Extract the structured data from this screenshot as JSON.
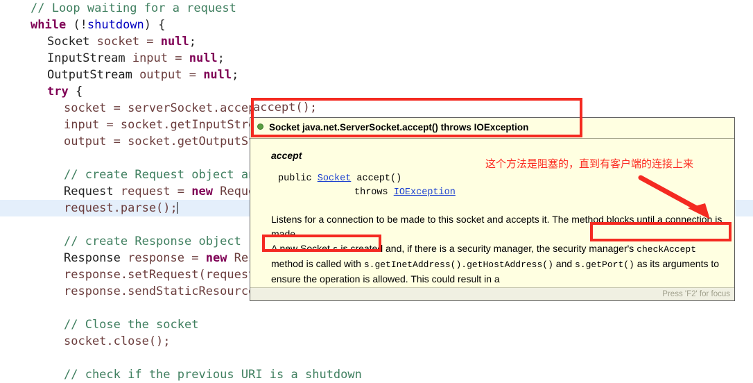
{
  "editor": {
    "lines": [
      {
        "indent": 1,
        "current": false,
        "tokens": [
          {
            "t": "// Loop waiting for a request",
            "c": "cm"
          }
        ]
      },
      {
        "indent": 1,
        "current": false,
        "tokens": [
          {
            "t": "while",
            "c": "kw"
          },
          {
            "t": " (!",
            "c": "pl"
          },
          {
            "t": "shutdown",
            "c": "fld"
          },
          {
            "t": ") {",
            "c": "pl"
          }
        ]
      },
      {
        "indent": 2,
        "current": false,
        "tokens": [
          {
            "t": "Socket",
            "c": "pl"
          },
          {
            "t": " socket = ",
            "c": "id"
          },
          {
            "t": "null",
            "c": "kw"
          },
          {
            "t": ";",
            "c": "pl"
          }
        ]
      },
      {
        "indent": 2,
        "current": false,
        "tokens": [
          {
            "t": "InputStream",
            "c": "pl"
          },
          {
            "t": " input = ",
            "c": "id"
          },
          {
            "t": "null",
            "c": "kw"
          },
          {
            "t": ";",
            "c": "pl"
          }
        ]
      },
      {
        "indent": 2,
        "current": false,
        "tokens": [
          {
            "t": "OutputStream",
            "c": "pl"
          },
          {
            "t": " output = ",
            "c": "id"
          },
          {
            "t": "null",
            "c": "kw"
          },
          {
            "t": ";",
            "c": "pl"
          }
        ]
      },
      {
        "indent": 2,
        "current": false,
        "tokens": [
          {
            "t": "try",
            "c": "kw"
          },
          {
            "t": " {",
            "c": "pl"
          }
        ]
      },
      {
        "indent": 3,
        "current": false,
        "tokens": [
          {
            "t": "socket = serverSocket.accept();",
            "c": "id"
          }
        ]
      },
      {
        "indent": 3,
        "current": false,
        "tokens": [
          {
            "t": "input = socket.getInputStream();",
            "c": "id"
          }
        ]
      },
      {
        "indent": 3,
        "current": false,
        "tokens": [
          {
            "t": "output = socket.getOutputStream();",
            "c": "id"
          }
        ]
      },
      {
        "indent": 3,
        "current": false,
        "tokens": [
          {
            "t": "",
            "c": "pl"
          }
        ]
      },
      {
        "indent": 3,
        "current": false,
        "tokens": [
          {
            "t": "// create Request object and parse",
            "c": "cm"
          }
        ]
      },
      {
        "indent": 3,
        "current": false,
        "tokens": [
          {
            "t": "Request",
            "c": "pl"
          },
          {
            "t": " request = ",
            "c": "id"
          },
          {
            "t": "new",
            "c": "kw"
          },
          {
            "t": " Request(input);",
            "c": "id"
          }
        ]
      },
      {
        "indent": 3,
        "current": true,
        "tokens": [
          {
            "t": "request.parse();",
            "c": "id"
          }
        ]
      },
      {
        "indent": 3,
        "current": false,
        "tokens": [
          {
            "t": "",
            "c": "pl"
          }
        ]
      },
      {
        "indent": 3,
        "current": false,
        "tokens": [
          {
            "t": "// create Response object",
            "c": "cm"
          }
        ]
      },
      {
        "indent": 3,
        "current": false,
        "tokens": [
          {
            "t": "Response",
            "c": "pl"
          },
          {
            "t": " response = ",
            "c": "id"
          },
          {
            "t": "new",
            "c": "kw"
          },
          {
            "t": " Response(output);",
            "c": "id"
          }
        ]
      },
      {
        "indent": 3,
        "current": false,
        "tokens": [
          {
            "t": "response.setRequest(request);",
            "c": "id"
          }
        ]
      },
      {
        "indent": 3,
        "current": false,
        "tokens": [
          {
            "t": "response.sendStaticResource();",
            "c": "id"
          }
        ]
      },
      {
        "indent": 3,
        "current": false,
        "tokens": [
          {
            "t": "",
            "c": "pl"
          }
        ]
      },
      {
        "indent": 3,
        "current": false,
        "tokens": [
          {
            "t": "// Close the socket",
            "c": "cm"
          }
        ]
      },
      {
        "indent": 3,
        "current": false,
        "tokens": [
          {
            "t": "socket.close();",
            "c": "id"
          }
        ]
      },
      {
        "indent": 3,
        "current": false,
        "tokens": [
          {
            "t": "",
            "c": "pl"
          }
        ]
      },
      {
        "indent": 3,
        "current": false,
        "tokens": [
          {
            "t": "// check if the previous URI is a shutdown",
            "c": "cm"
          }
        ]
      }
    ],
    "code_strip_text": "accept();"
  },
  "popup": {
    "header": "Socket java.net.ServerSocket.accept() throws IOException",
    "member_name": "accept",
    "signature_line1_pre": "public ",
    "signature_line1_link": "Socket",
    "signature_line1_post": " accept()",
    "signature_line2_pre": "throws ",
    "signature_line2_link": "IOException",
    "paragraph1_a": "Listens for a connection to be made to this socket and accepts it. ",
    "paragraph1_b": "The method blocks until a connection is made.",
    "paragraph2_a": "A new Socket ",
    "paragraph2_mono1": "s",
    "paragraph2_b": " is created and, if there is a security manager, the security manager's ",
    "paragraph2_mono2": "checkAccept",
    "paragraph2_c": " method is called with ",
    "paragraph2_mono3": "s.getInetAddress().getHostAddress()",
    "paragraph2_d": " and ",
    "paragraph2_mono4": "s.getPort()",
    "paragraph2_e": " as its arguments to ensure the operation is allowed. This could result in a",
    "footer": "Press 'F2' for focus"
  },
  "annotations": {
    "chinese_note": "这个方法是阻塞的，直到有客户端的连接上来",
    "highlight_color": "#f42a21"
  }
}
